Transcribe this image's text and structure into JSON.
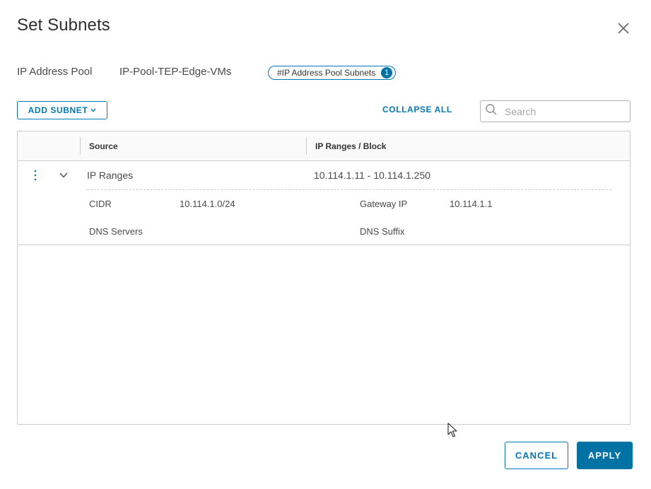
{
  "dialog": {
    "title": "Set Subnets",
    "close_icon": "close-icon"
  },
  "pool": {
    "label": "IP Address Pool",
    "name": "IP-Pool-TEP-Edge-VMs"
  },
  "tag": {
    "label": "#IP Address Pool Subnets",
    "count": "1"
  },
  "toolbar": {
    "add_subnet_label": "ADD SUBNET",
    "add_subnet_caret_icon": "chevron-down-icon",
    "collapse_all_label": "COLLAPSE ALL",
    "search_placeholder": "Search",
    "search_icon": "search-icon"
  },
  "grid": {
    "columns": [
      "Source",
      "IP Ranges / Block"
    ],
    "rows": [
      {
        "source": "IP Ranges",
        "ip_ranges": "10.114.1.11 - 10.114.1.250",
        "expanded": true,
        "details": {
          "cidr_label": "CIDR",
          "cidr_value": "10.114.1.0/24",
          "gateway_label": "Gateway IP",
          "gateway_value": "10.114.1.1",
          "dns_servers_label": "DNS Servers",
          "dns_suffix_label": "DNS Suffix"
        }
      }
    ]
  },
  "footer": {
    "cancel_label": "CANCEL",
    "apply_label": "APPLY"
  },
  "colors": {
    "accent": "#0079b8",
    "primary_button": "#0072a3",
    "border": "#cccccc"
  }
}
